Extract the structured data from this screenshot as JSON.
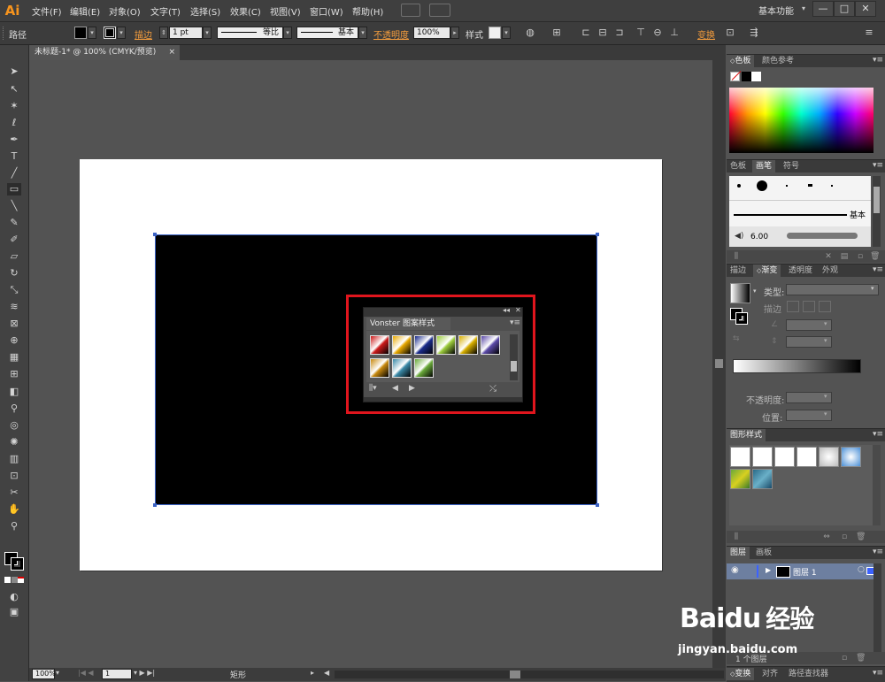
{
  "app": {
    "logo": "Ai",
    "workspace": "基本功能"
  },
  "menu": [
    "文件(F)",
    "编辑(E)",
    "对象(O)",
    "文字(T)",
    "选择(S)",
    "效果(C)",
    "视图(V)",
    "窗口(W)",
    "帮助(H)"
  ],
  "window_controls": {
    "min": "—",
    "max": "□",
    "close": "✕"
  },
  "control_bar": {
    "object_type": "路径",
    "stroke_label": "描边",
    "stroke_weight": "1 pt",
    "stroke_profile": "等比",
    "brush": "基本",
    "opacity_label": "不透明度",
    "opacity_value": "100%",
    "style_label": "样式",
    "transform_label": "变换"
  },
  "document_tab": {
    "title": "未标题-1* @ 100% (CMYK/预览)",
    "close": "×"
  },
  "library_panel": {
    "title": "Vonster 图案样式",
    "swatch_colors": [
      "#cc1a1a",
      "#e8a800",
      "#1a2c8c",
      "#9ccc3c",
      "#d8b000",
      "#5b4aa8",
      "#c88a10",
      "#3a8aa8",
      "#6aaa3a"
    ]
  },
  "color_panel": {
    "tabs": [
      "色板",
      "颜色参考"
    ]
  },
  "brush_panel": {
    "tabs": [
      "色板",
      "画笔",
      "符号"
    ],
    "basic_label": "基本",
    "size_value": "6.00"
  },
  "gradient_panel": {
    "tabs": [
      "描边",
      "渐变",
      "透明度",
      "外观"
    ],
    "type_label": "类型:",
    "stroke_label": "描边",
    "opacity_label": "不透明度:",
    "position_label": "位置:"
  },
  "graphic_styles_panel": {
    "title": "图形样式"
  },
  "layers_panel": {
    "tabs": [
      "图层",
      "画板"
    ],
    "layer_name": "图层 1",
    "count_label": "1 个图层"
  },
  "bottom_tabs": [
    "变换",
    "对齐",
    "路径查找器"
  ],
  "status_bar": {
    "zoom": "100%",
    "page": "1",
    "tool": "矩形"
  },
  "watermark": {
    "brand": "Baidu",
    "name": "经验",
    "url": "jingyan.baidu.com"
  }
}
